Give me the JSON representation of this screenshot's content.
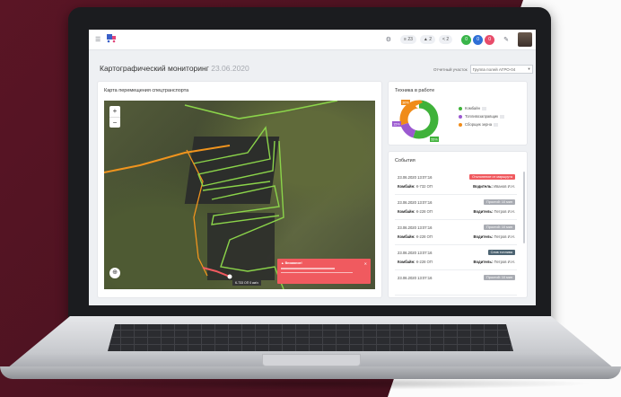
{
  "header": {
    "menu_icon": "menu-icon",
    "logo_icon": "truck-logo-icon",
    "pills": [
      "23",
      "2",
      "2"
    ],
    "circles": [
      {
        "label": "0",
        "color": "#39b54a"
      },
      {
        "label": "0",
        "color": "#2f6fd6"
      },
      {
        "label": "0",
        "color": "#e84c6a"
      }
    ]
  },
  "page": {
    "title": "Картографический мониторинг",
    "date": "23.06.2020",
    "period_label": "Отчетный участок",
    "period_value": "Группа полей АГРО-04"
  },
  "map_card": {
    "title": "Карта перемещения спецтранспорта",
    "zoom_in": "+",
    "zoom_out": "−",
    "alert_title": "Внимание!",
    "scale": "К-733 ОП 0 км/ч"
  },
  "tech_card": {
    "title": "Техника в работе",
    "legend": [
      {
        "label": "Комбайн",
        "color": "#3fb23a"
      },
      {
        "label": "Топливозаправщик",
        "color": "#9b59d0"
      },
      {
        "label": "Сборщик зерна",
        "color": "#f08c1a"
      }
    ],
    "donut_labels": [
      "30%",
      "15%",
      "55%"
    ],
    "donut_values": [
      55,
      15,
      30
    ]
  },
  "events_card": {
    "title": "События",
    "events": [
      {
        "date": "23.06.2020 13:07:16",
        "tag": "Отклонение от маршрута",
        "tag_color": "#f05a5f",
        "machine_label": "Комбайн:",
        "machine": "К-732 ОП",
        "driver_label": "Водитель:",
        "driver": "Иванов И.Н."
      },
      {
        "date": "23.06.2020 13:07:16",
        "tag": "Простой: 10 мин",
        "tag_color": "#a9acb3",
        "machine_label": "Комбайн:",
        "machine": "К-228 ОП",
        "driver_label": "Водитель:",
        "driver": "Петров И.Н."
      },
      {
        "date": "23.06.2020 13:07:16",
        "tag": "Простой: 10 мин",
        "tag_color": "#a9acb3",
        "machine_label": "Комбайн:",
        "machine": "К-228 ОП",
        "driver_label": "Водитель:",
        "driver": "Петров И.Н."
      },
      {
        "date": "23.06.2020 13:07:16",
        "tag": "Слив топлива",
        "tag_color": "#4d6472",
        "machine_label": "Комбайн:",
        "machine": "К-228 ОП",
        "driver_label": "Водитель:",
        "driver": "Петров И.Н."
      },
      {
        "date": "23.06.2020 13:07:16",
        "tag": "Простой: 10 мин",
        "tag_color": "#a9acb3",
        "machine_label": "",
        "machine": "",
        "driver_label": "",
        "driver": ""
      }
    ]
  }
}
